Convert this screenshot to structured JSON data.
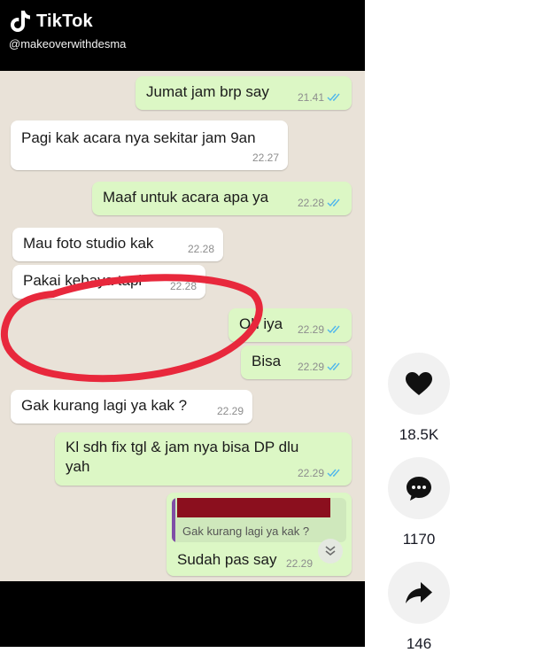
{
  "tiktok": {
    "brand": "TikTok",
    "handle": "@makeoverwithdesma"
  },
  "messages": [
    {
      "dir": "out",
      "text": "Jumat jam brp say",
      "time": "21.41"
    },
    {
      "dir": "in",
      "text": "Pagi kak acara nya sekitar jam 9an",
      "time": "22.27"
    },
    {
      "dir": "out",
      "text": "Maaf untuk acara apa ya",
      "time": "22.28"
    },
    {
      "dir": "in",
      "text": "Mau foto studio kak",
      "time": "22.28"
    },
    {
      "dir": "in",
      "text": "Pakai kebaya tapi",
      "time": "22.28"
    },
    {
      "dir": "out",
      "text": "Oh iya",
      "time": "22.29"
    },
    {
      "dir": "out",
      "text": "Bisa",
      "time": "22.29"
    },
    {
      "dir": "in",
      "text": "Gak kurang lagi ya kak ?",
      "time": "22.29"
    },
    {
      "dir": "out",
      "text": "Kl sdh fix tgl & jam nya bisa DP dlu yah",
      "time": "22.29"
    },
    {
      "dir": "out",
      "text": "Sudah pas say",
      "time": "22.29",
      "quoted": "Gak kurang lagi ya kak ?"
    }
  ],
  "actions": {
    "like_count": "18.5K",
    "comment_count": "1170",
    "share_count": "146"
  },
  "colors": {
    "highlight": "#e8283c",
    "incoming_bubble": "#ffffff",
    "outgoing_bubble": "#dcf7c5",
    "read_ticks": "#4fb6ec"
  },
  "icons": [
    "tiktok-logo-icon",
    "read-ticks-icon",
    "heart-icon",
    "comment-icon",
    "share-icon",
    "chevron-down-icon"
  ]
}
